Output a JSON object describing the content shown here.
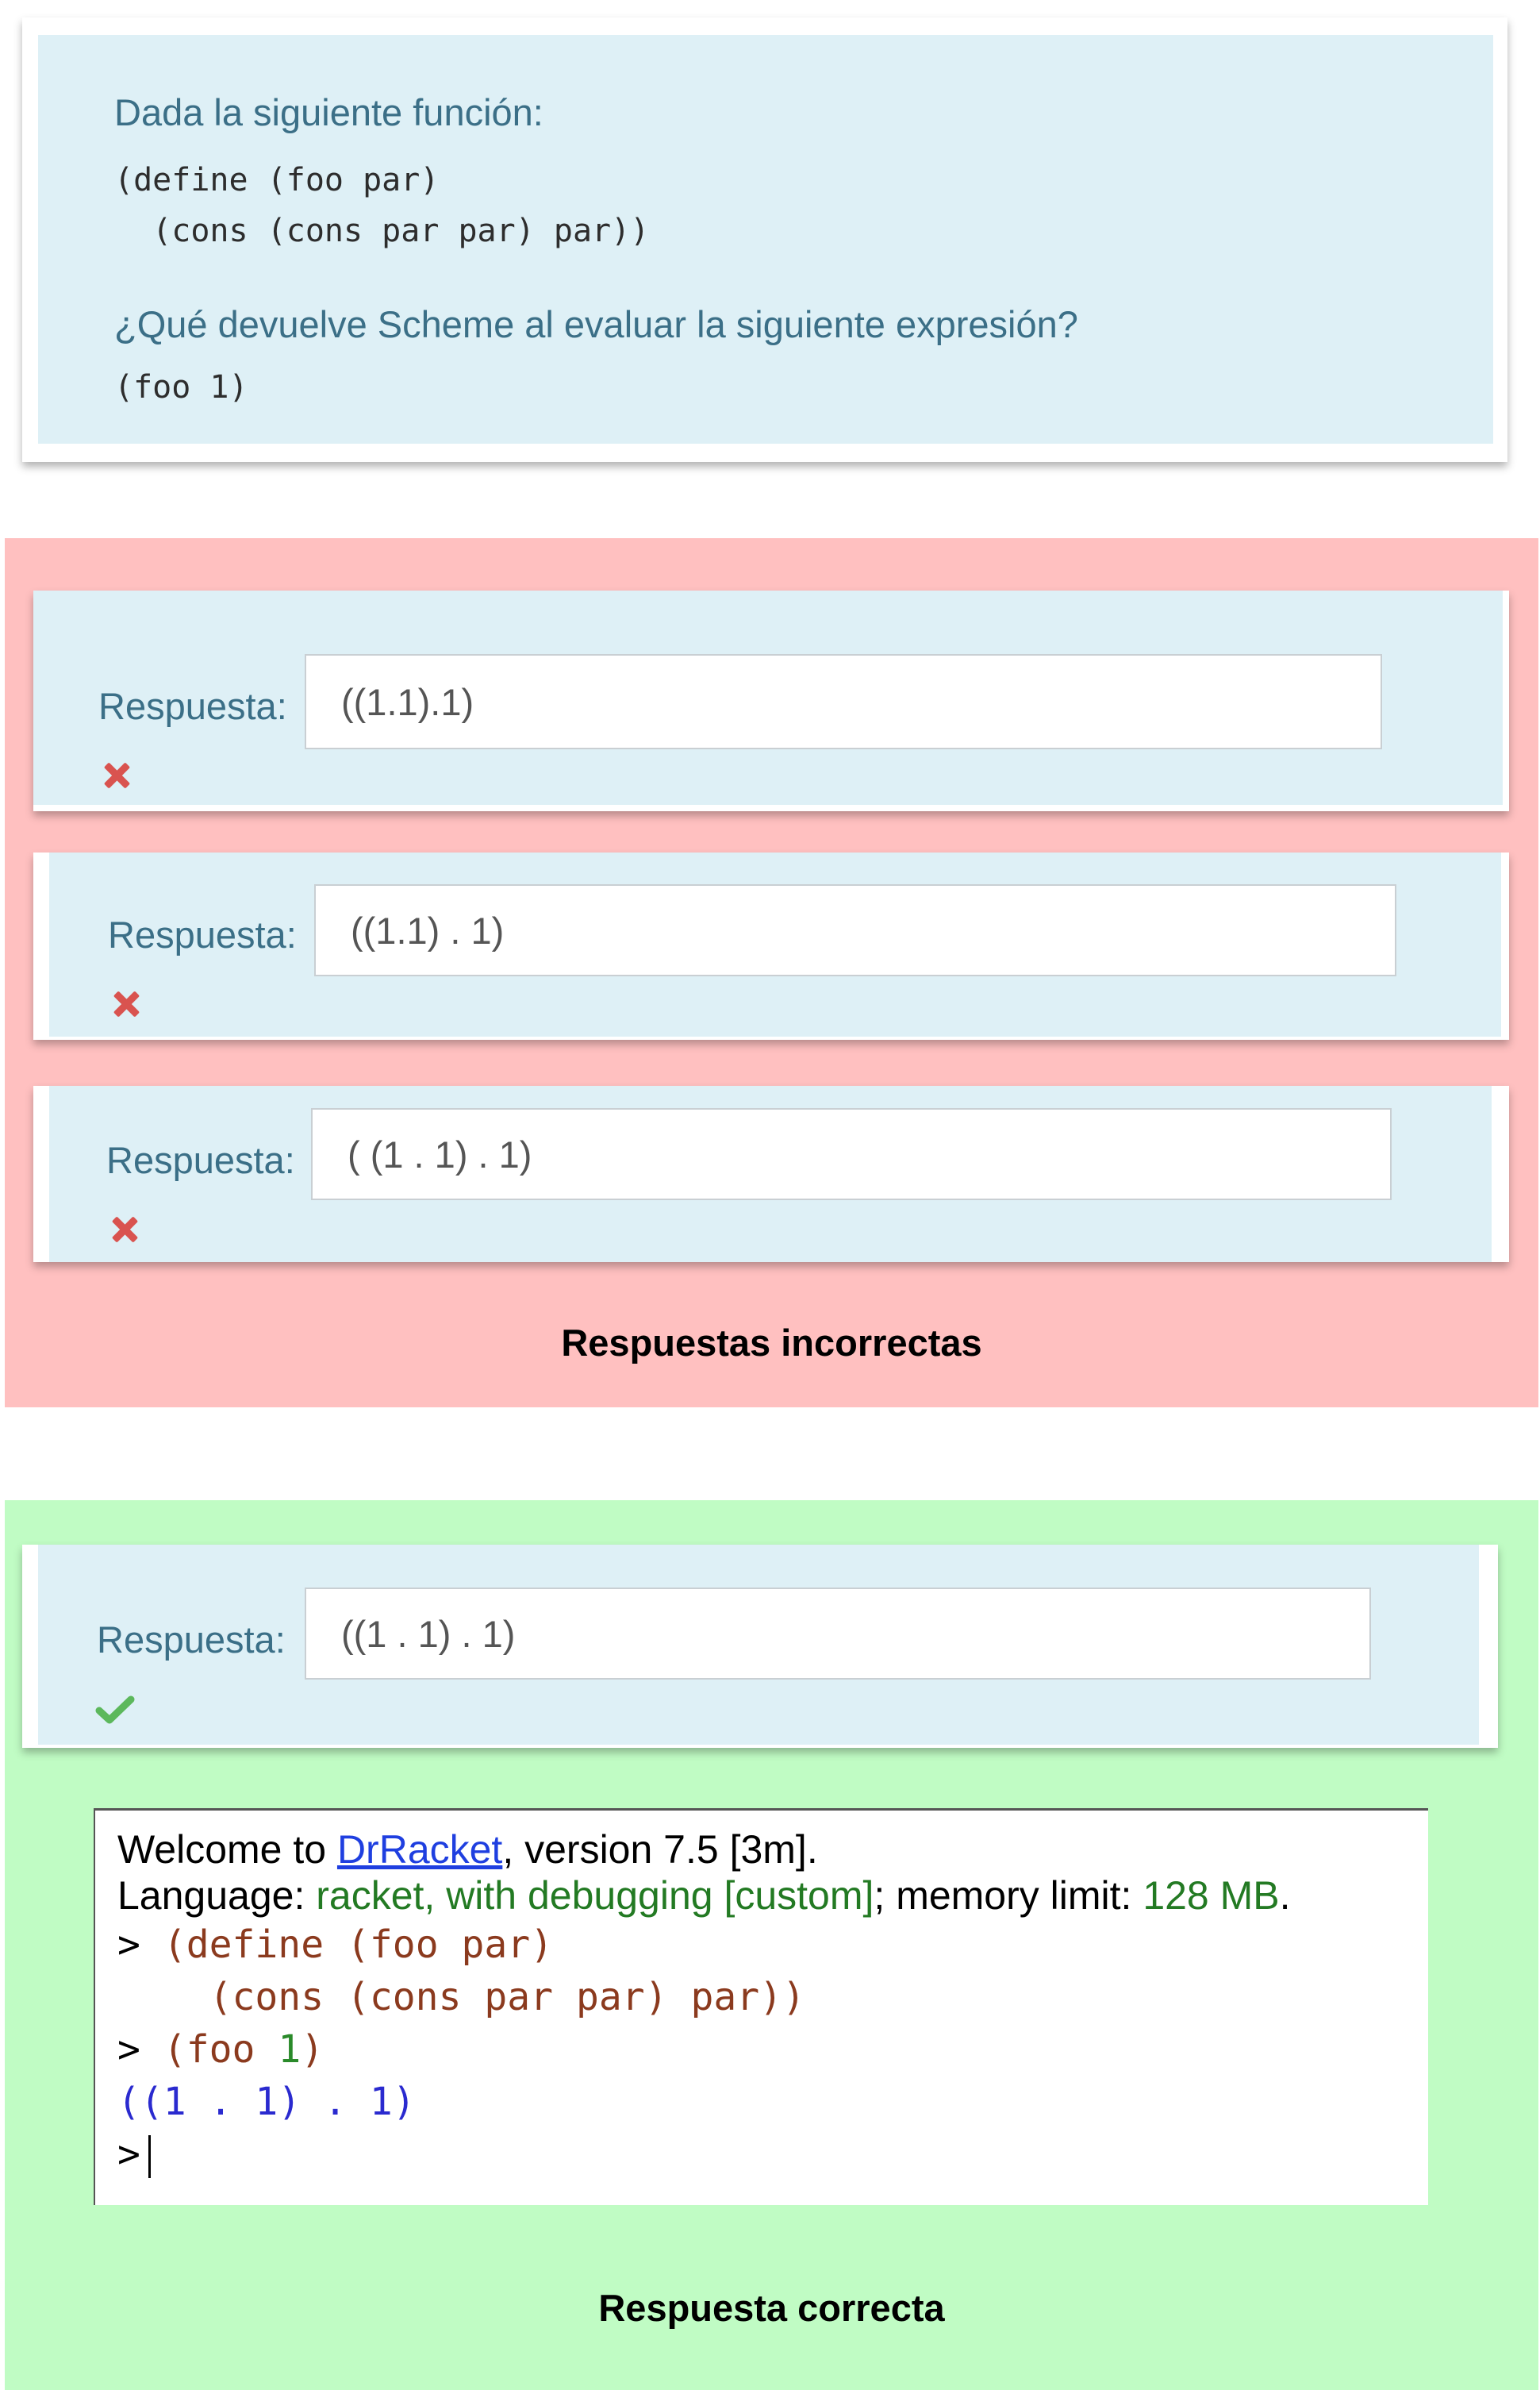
{
  "question": {
    "intro": "Dada la siguiente función:",
    "code_lines": [
      "(define (foo par)",
      "  (cons (cons par par) par))"
    ],
    "prompt": "¿Qué devuelve Scheme al evaluar la siguiente expresión?",
    "expression": "(foo 1)"
  },
  "incorrect": {
    "caption": "Respuestas incorrectas",
    "answers": [
      {
        "label": "Respuesta:",
        "value": "((1.1).1)",
        "status": "incorrect"
      },
      {
        "label": "Respuesta:",
        "value": "((1.1) . 1)",
        "status": "incorrect"
      },
      {
        "label": "Respuesta:",
        "value": "( (1 . 1) . 1)",
        "status": "incorrect"
      }
    ]
  },
  "correct": {
    "caption": "Respuesta correcta",
    "answer": {
      "label": "Respuesta:",
      "value": "((1 . 1) . 1)",
      "status": "correct"
    }
  },
  "drracket": {
    "welcome_prefix": "Welcome to ",
    "welcome_link": "DrRacket",
    "welcome_suffix": ", version 7.5 [3m].",
    "language_prefix": "Language: ",
    "language_value": "racket, with debugging [custom]",
    "memory_prefix": "; memory limit: ",
    "memory_value": "128 MB",
    "memory_suffix": ".",
    "prompt_symbol": ">",
    "define_line1": "(define (foo par)",
    "define_line2": "(cons (cons par par) par))",
    "call_open": "(foo ",
    "call_arg": "1",
    "call_close": ")",
    "result": "((1 . 1) . 1)"
  },
  "colors": {
    "incorrect_bg": "#ffc0c0",
    "correct_bg": "#c0fcc4",
    "card_bg": "#def0f6",
    "wrong_mark": "#d9534f",
    "right_mark": "#5cb85c"
  }
}
